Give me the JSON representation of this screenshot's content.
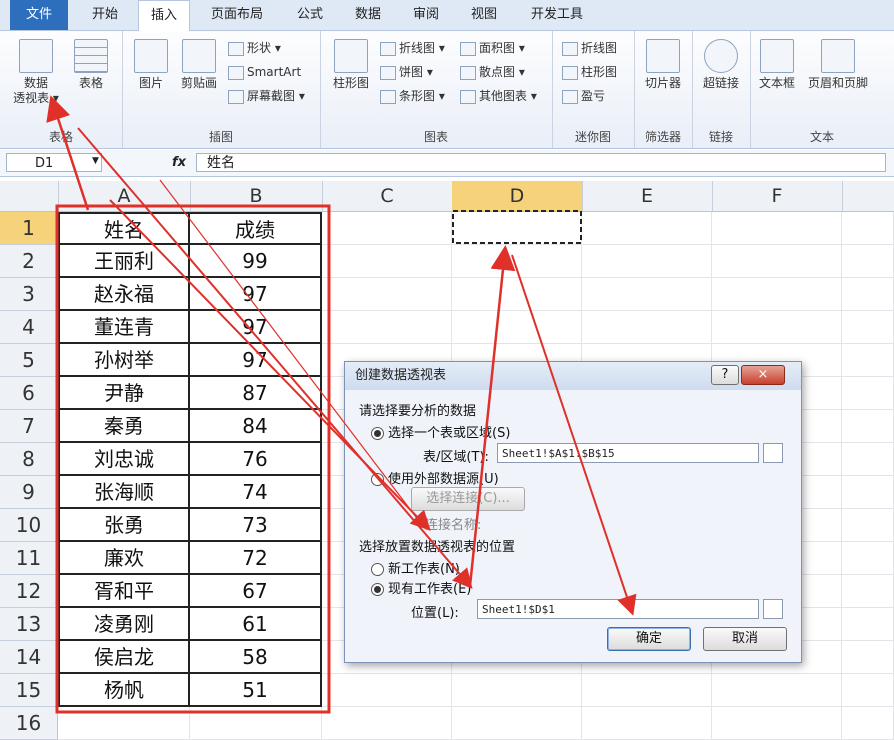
{
  "tabs": [
    "文件",
    "开始",
    "插入",
    "页面布局",
    "公式",
    "数据",
    "审阅",
    "视图",
    "开发工具"
  ],
  "ribbon": {
    "groups": {
      "tables": "表格",
      "illustrations": "插图",
      "charts": "图表",
      "sparklines": "迷你图",
      "filter": "筛选器",
      "links": "链接",
      "text": "文本"
    },
    "buttons": {
      "pivot_line1": "数据",
      "pivot_line2": "透视表 ▾",
      "table": "表格",
      "picture": "图片",
      "clipart": "剪贴画",
      "shapes": "形状 ▾",
      "smartart": "SmartArt",
      "screenshot": "屏幕截图 ▾",
      "column": "柱形图",
      "line": "折线图 ▾",
      "pie": "饼图 ▾",
      "bar": "条形图 ▾",
      "area": "面积图 ▾",
      "scatter": "散点图 ▾",
      "other": "其他图表 ▾",
      "spark_line": "折线图",
      "spark_column": "柱形图",
      "spark_winloss": "盈亏",
      "slicer": "切片器",
      "hyperlink": "超链接",
      "textbox": "文本框",
      "headerfooter": "页眉和页脚"
    }
  },
  "formula_bar": {
    "name_box": "D1",
    "fx": "fx",
    "content": "姓名"
  },
  "columns": [
    "A",
    "B",
    "C",
    "D",
    "E",
    "F"
  ],
  "rows": [
    "1",
    "2",
    "3",
    "4",
    "5",
    "6",
    "7",
    "8",
    "9",
    "10",
    "11",
    "12",
    "13",
    "14",
    "15",
    "16"
  ],
  "table": {
    "headers": [
      "姓名",
      "成绩"
    ],
    "names": [
      "王丽利",
      "赵永福",
      "董连青",
      "孙树举",
      "尹静",
      "秦勇",
      "刘忠诚",
      "张海顺",
      "张勇",
      "廉欢",
      "胥和平",
      "凌勇刚",
      "侯启龙",
      "杨帆"
    ],
    "scores": [
      "99",
      "97",
      "97",
      "97",
      "87",
      "84",
      "76",
      "74",
      "73",
      "72",
      "67",
      "61",
      "58",
      "51"
    ]
  },
  "dialog": {
    "title": "创建数据透视表",
    "section1": "请选择要分析的数据",
    "option_range": "选择一个表或区域(S)",
    "range_label": "表/区域(T):",
    "range_value": "Sheet1!$A$1:$B$15",
    "option_external": "使用外部数据源(U)",
    "choose_connection": "选择连接(C)...",
    "connection_name": "连接名称:",
    "section2": "选择放置数据透视表的位置",
    "option_new_sheet": "新工作表(N)",
    "option_existing": "现有工作表(E)",
    "location_label": "位置(L):",
    "location_value": "Sheet1!$D$1",
    "ok": "确定",
    "cancel": "取消",
    "help": "?",
    "close": "×"
  },
  "colors": {
    "annotation_red": "#e0302a",
    "file_tab": "#2e6fbd",
    "selected_row_header": "#f6d37a"
  }
}
